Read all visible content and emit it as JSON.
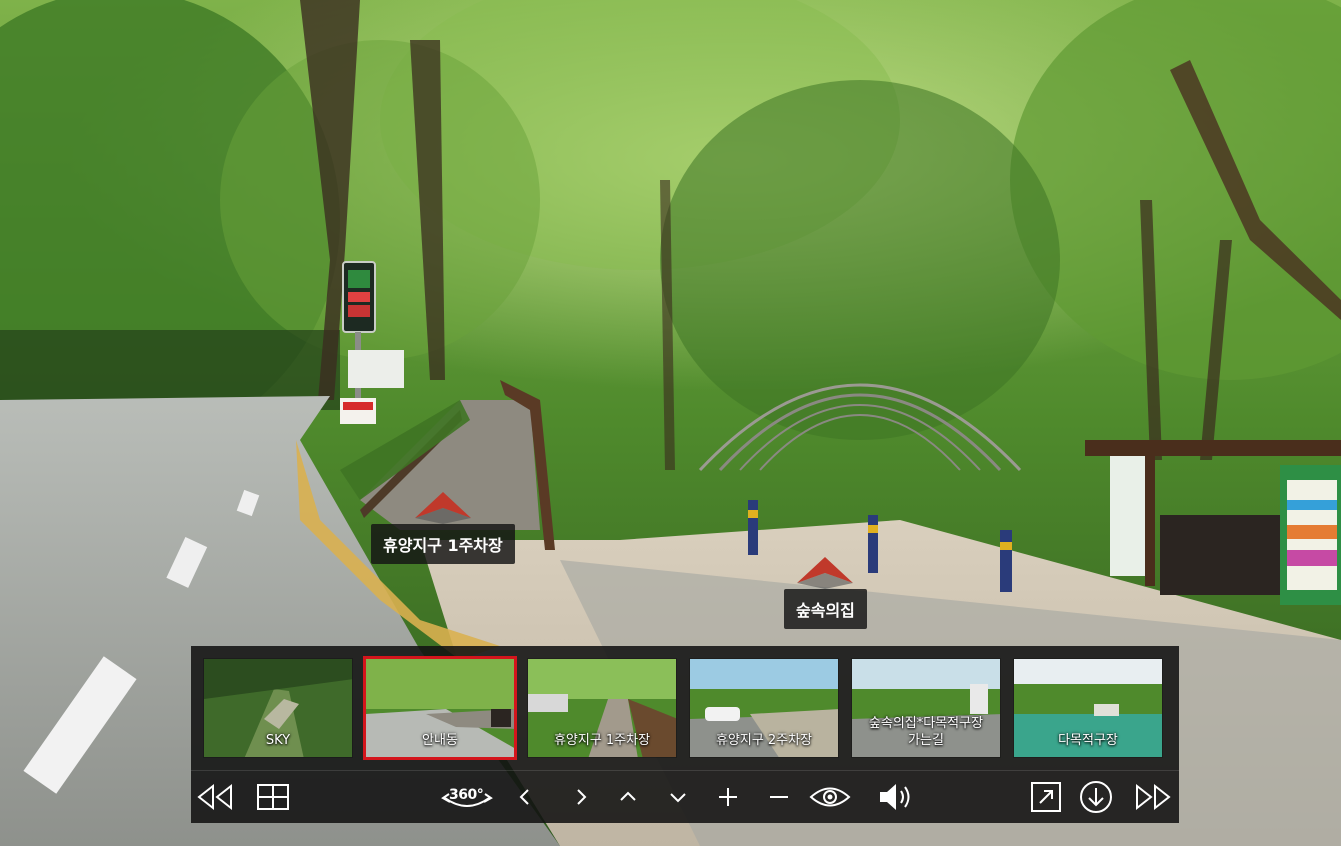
{
  "hotspots": [
    {
      "label": "휴양지구 1주차장"
    },
    {
      "label": "숲속의집"
    }
  ],
  "thumbnails": [
    {
      "label": "SKY",
      "selected": false
    },
    {
      "label": "안내동",
      "selected": true
    },
    {
      "label": "휴양지구 1주차장",
      "selected": false
    },
    {
      "label": "휴양지구 2주차장",
      "selected": false
    },
    {
      "label_line1": "숲속의집*다목적구장",
      "label_line2": "가는길",
      "selected": false
    },
    {
      "label": "다목적구장",
      "selected": false
    }
  ],
  "controls": {
    "rotate_label": "360°"
  },
  "colors": {
    "panel_bg": "#121212",
    "active_border": "#d4151c",
    "hotspot_arrow": "#c0392b"
  }
}
